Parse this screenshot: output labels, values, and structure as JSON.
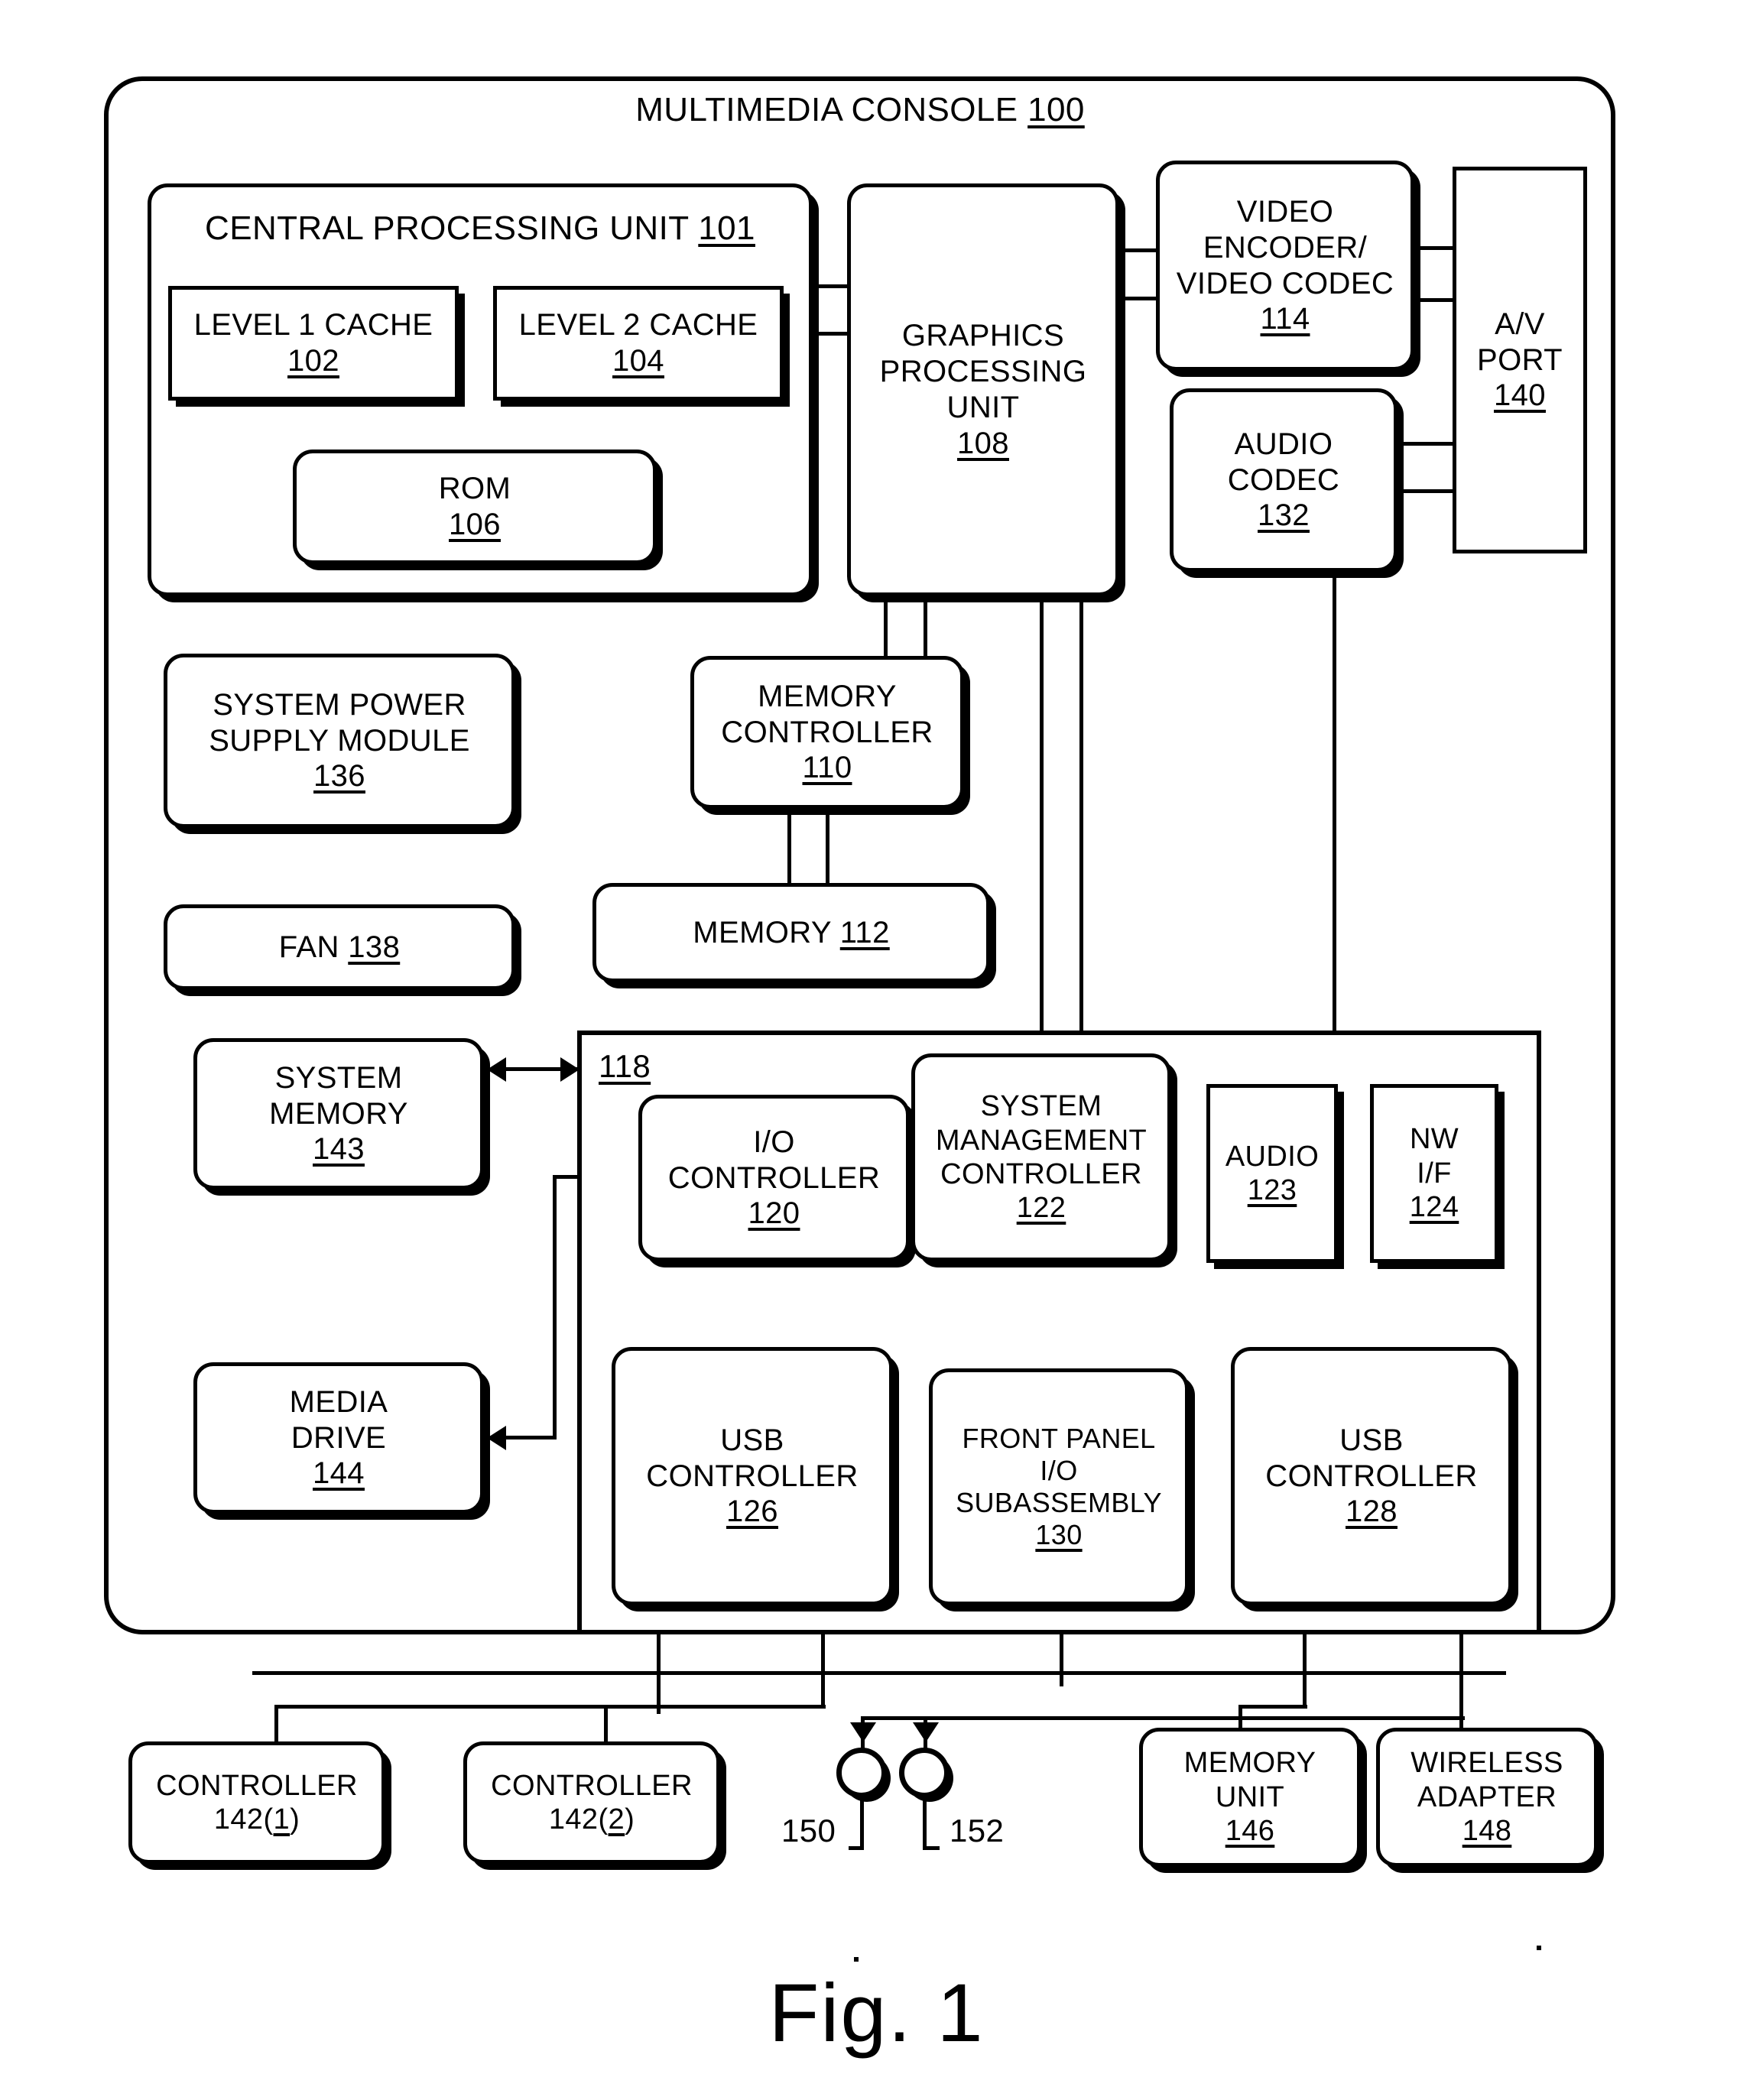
{
  "figure": {
    "caption": "Fig. 1",
    "title": "Multimedia Console",
    "title_ref": "100"
  },
  "blocks": {
    "cpu": {
      "lines": [
        "Central Processing Unit"
      ],
      "ref": "101"
    },
    "l1cache": {
      "lines": [
        "Level 1 Cache"
      ],
      "ref": "102"
    },
    "l2cache": {
      "lines": [
        "Level 2 Cache"
      ],
      "ref": "104"
    },
    "rom": {
      "lines": [
        "ROM"
      ],
      "ref": "106"
    },
    "gpu": {
      "lines": [
        "Graphics",
        "Processing",
        "Unit"
      ],
      "ref": "108"
    },
    "video_enc": {
      "lines": [
        "Video",
        "Encoder/",
        "Video Codec"
      ],
      "ref": "114"
    },
    "av_port": {
      "lines": [
        "A/V",
        "Port"
      ],
      "ref": "140"
    },
    "audio_codec": {
      "lines": [
        "Audio",
        "Codec"
      ],
      "ref": "132"
    },
    "mem_ctrl": {
      "lines": [
        "Memory",
        "Controller"
      ],
      "ref": "110"
    },
    "memory": {
      "lines": [
        "Memory"
      ],
      "ref": "112"
    },
    "psu": {
      "lines": [
        "System Power",
        "Supply Module"
      ],
      "ref": "136"
    },
    "fan": {
      "lines": [
        "Fan"
      ],
      "ref": "138"
    },
    "sys_mem": {
      "lines": [
        "System",
        "Memory"
      ],
      "ref": "143"
    },
    "media_drive": {
      "lines": [
        "Media",
        "Drive"
      ],
      "ref": "144"
    },
    "io_container": {
      "ref": "118"
    },
    "io_ctrl": {
      "lines": [
        "I/O",
        "Controller"
      ],
      "ref": "120"
    },
    "smc": {
      "lines": [
        "System",
        "Management",
        "Controller"
      ],
      "ref": "122"
    },
    "audio": {
      "lines": [
        "Audio"
      ],
      "ref": "123"
    },
    "nwif": {
      "lines": [
        "NW",
        "I/F"
      ],
      "ref": "124"
    },
    "usb126": {
      "lines": [
        "USB",
        "Controller"
      ],
      "ref": "126"
    },
    "front_panel": {
      "lines": [
        "Front Panel",
        "I/O",
        "Subassembly"
      ],
      "ref": "130"
    },
    "usb128": {
      "lines": [
        "USB",
        "Controller"
      ],
      "ref": "128"
    },
    "ctrl1": {
      "lines": [
        "Controller"
      ],
      "ref": "142(1)"
    },
    "ctrl2": {
      "lines": [
        "Controller"
      ],
      "ref": "142(2)"
    },
    "mem_unit": {
      "lines": [
        "Memory",
        "Unit"
      ],
      "ref": "146"
    },
    "wireless": {
      "lines": [
        "Wireless",
        "Adapter"
      ],
      "ref": "148"
    }
  },
  "markers": {
    "m150": "150",
    "m152": "152"
  },
  "colors": {
    "ink": "#000000",
    "paper": "#ffffff"
  }
}
